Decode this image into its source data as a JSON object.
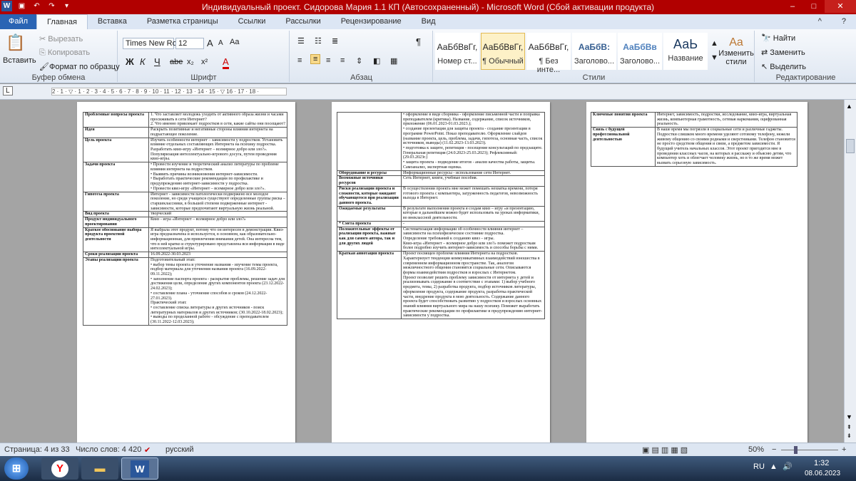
{
  "window": {
    "title": "Индивидуальный проект. Сидорова Мария 1.1 КП (Автосохраненный)  -  Microsoft Word (Сбой активации продукта)",
    "min": "–",
    "max": "□",
    "close": "✕",
    "app_icon": "W"
  },
  "ribbon_tabs": [
    "Файл",
    "Главная",
    "Вставка",
    "Разметка страницы",
    "Ссылки",
    "Рассылки",
    "Рецензирование",
    "Вид"
  ],
  "ribbon_right": {
    "help": "?",
    "collapse": "^"
  },
  "clipboard": {
    "paste": "Вставить",
    "cut": "Вырезать",
    "copy": "Копировать",
    "format": "Формат по образцу",
    "label": "Буфер обмена"
  },
  "font": {
    "name": "Times New Ro",
    "size": "12",
    "label": "Шрифт",
    "bold": "Ж",
    "italic": "К",
    "underline": "Ч",
    "strike": "abe",
    "sub": "x₂",
    "sup": "x²",
    "grow": "A",
    "shrink": "A",
    "clear": "Aa",
    "color": "A"
  },
  "paragraph": {
    "label": "Абзац",
    "pilcrow": "¶"
  },
  "styles": {
    "label": "Стили",
    "items": [
      {
        "preview": "АаБбВвГг,",
        "name": "Номер ст..."
      },
      {
        "preview": "АаБбВвГг,",
        "name": "¶ Обычный"
      },
      {
        "preview": "АаБбВвГг,",
        "name": "¶ Без инте..."
      },
      {
        "preview": "АаБбВ:",
        "name": "Заголово..."
      },
      {
        "preview": "АаБбВв",
        "name": "Заголово..."
      },
      {
        "preview": "АаЬ",
        "name": "Название"
      }
    ],
    "change": "Изменить стили"
  },
  "editing": {
    "label": "Редактирование",
    "find": "Найти",
    "replace": "Заменить",
    "select": "Выделить"
  },
  "ruler": {
    "corner": "L",
    "ticks": "2 · 1 · ▽ · 1 · 2 · 3 · 4 · 5 · 6 · 7 · 8 · 9 · 10 · 11 · 12 · 13 · 14 · 15 · ▽ 16 · 17 · 18 ·"
  },
  "page1": [
    {
      "k": "Проблемные вопросы проекта",
      "v": [
        "1. Что заставляет молодежь уходить от активного образа жизни и часами просиживать в сети Интернет?",
        "2. Что именно привлекает подростков в сети, какие сайты они посещают?"
      ]
    },
    {
      "k": "Идея",
      "v": [
        "Раскрыть позитивные и негативные стороны влияния интернета на подрастающее поколение."
      ]
    },
    {
      "k": "Цель проекта",
      "v": [
        "Изучить особенности интернет – зависимости у подростков. Установить влияние отдельных составляющих Интернета на психику подростка. Разработать квиз-игру «Интернет – всемирное добро или зло?». Популяризация интеллектуально-игрового досуга, путем проведения квиз-игры."
      ]
    },
    {
      "k": "Задачи проекта",
      "v": [
        "• Провести изучение и теоретический анализ литературы по проблеме влияния интернета на подростков.",
        "• Выявить причины возникновения интернет-зависимости.",
        "• Выработать практические рекомендации по профилактике и предупреждению интернет-зависимости у подростка.",
        "• Провести квиз-игру «Интернет – всемирное добро или зло?»."
      ]
    },
    {
      "k": "Гипотеза проекта",
      "v": [
        "Интернет - зависимости патологически подвержено все молодое поколение, но среди учащихся существуют определенные группы риска – старшеклассники, в большей степени подверженные интернет - зависимости, которые предпочитают виртуальную жизнь реальной."
      ]
    },
    {
      "k": "Вид проекта",
      "v": [
        "творческий"
      ]
    },
    {
      "k": "Продукт индивидуального проектирования",
      "v": [
        "Квиз - игра «Интернет – всемирное добро или зло?»"
      ]
    },
    {
      "k": "Краткое обоснование выбора продукта проектной деятельности",
      "v": [
        "Я выбрала этот продукт, потому что он интересен в демонстрации. Квиз-игра предназначена и используется, в основном, как образовательно-информационная, для привлечения внимания детей. Она интересна тем, что в ней кратко и структурировано представлена вся информация в виде интеллектуальной игры."
      ]
    },
    {
      "k": "Сроки реализации проекта",
      "v": [
        "16.09.2022-30.03.2023"
      ]
    },
    {
      "k": "Этапы реализации проекта",
      "v": [
        "Подготовительный этап:",
        "• выбор темы проекта и уточнение названия - изучение темы проекта, подбор материала для уточнения названия проекта (16.09.2022-09.11.2022);",
        "• заполнение паспорта проекта - раскрытие проблемы, решение задач для достижения цели, определение других компонентов проекта (23.12.2022-24.02.2023);",
        "• составление плана - уточнение способов и сроков (24.12.2022-27.01.2023).",
        "Практический этап:",
        "• составление списка литературы и других источников - поиск литературных материалов и других источников; (30.10.2022-18.02.2023);",
        "• выводы по проделанной работе - обсуждение с преподавателем (30.11.2022-12.03.2023);"
      ]
    }
  ],
  "page2": [
    {
      "k": "",
      "v": [
        "• оформление в виде сборника - оформление письменной части и поправка преподавателем (критика). Название, содержание, список источников, приложение (06.01.2023-01.03.2023.);",
        "• создание презентации для защиты проекта - создание презентации в программе PowerPoint. Показ преподавателю. Оформление слайдов (название проекта, цель, проблема, задачи, гипотеза, основная часть, список источников, выводы) (11.02.2023-13.03.2023).",
        "• подготовка к защите, репетиция - посещение консультаций по предзащите. Генеральная репетиция (24.0.2023-25.03.2023); Рефлексивный: (29.03.2023г.)",
        "• защита проекта - подведение итогов - анализ качества работы, защиты. Самоанализ, экспертная оценка."
      ]
    },
    {
      "k": "Оборудование и ресурсы",
      "v": [
        "Информационные ресурсы - использование сети Интернет."
      ]
    },
    {
      "k": "Возможные источники ресурсов",
      "v": [
        "Сеть Интернет, книги, учебные пособия."
      ]
    },
    {
      "k": "Риски реализации проекта и сложности, которые ожидают обучающегося при реализации данного проекта.",
      "v": [
        "В осуществлении проекта мне может помешать нехватка времени, потеря готового проекта с компьютера, загруженность педагогов, невозможность выхода в Интернет."
      ]
    },
    {
      "k": "Ожидаемые результаты",
      "v": [
        "В результате выполнения проекта я создам квиз – игру «и презентацию, которые в дальнейшем можно будет использовать на уроках информатики, во внеклассной деятельности."
      ]
    },
    {
      "k": "* Смета проекта",
      "v": [
        "-"
      ]
    },
    {
      "k": "Положительные эффекты от реализации проекта, важные как для самого автора, так и для других людей",
      "v": [
        "Систематизация информации об особенности влияния интернет – зависимости на психофизическое состояние подростка.",
        "Определение требований к созданию квиз – игры.",
        "Квиз-игра «Интернет – всемирное добро или зло?» поможет подросткам более подробно изучить интернет-зависимость и способы борьбы с ними."
      ]
    },
    {
      "k": "Краткая аннотация проекта",
      "v": [
        "Проект посвящен проблеме влияния Интернета на подростков. Характеризует тенденции коммуникативных взаимодействий юношества в современном информационном пространстве. Так, аналогом межличностного общения становятся социальные сети. Описываются формы взаимодействия подростков и взрослых с Интернетом.",
        "Проект позволит решить проблему зависимости от интернета у детей и реализовывать содержание в соответствие с этапами: 1) выбор учебного предмета, темы, 2) разработка продукта, подбор источников литературы, оформление продукта, содержание продукта, разработка практической части, внедрение продукта в мою деятельность. Содержание данного проекта будет способствовать развитию у подростков и взрослых основных знаний влияния виртуального мира на нашу психику. Поможет выработать практические рекомендации по профилактике и предупреждению интернет-зависимости у подростка."
      ]
    }
  ],
  "page3": [
    {
      "k": "Ключевые понятия проекта",
      "v": [
        "Интернет, зависимость, подростки, исследование, квиз-игра, виртуальная жизнь, компьютерная грамотность, сетевая наркомания, оцифрованная реальность."
      ]
    },
    {
      "k": "Связь с будущей профессиональной деятельностью",
      "v": [
        "В наше время мы погрязли в социальные сети и различные гаджеты.",
        "Подростки слишком много времени уделяют сотовому телефону, нежели живому общению со своими родными и сверстниками. Телефон становится не просто средством общения и связи, а предметом зависимости. Я будущий учитель начальных классов. Этот проект пригодится мне в проведении классных часов, на которых я расскажу и объясню детям, что компьютер хоть и облегчает человеку жизнь, но в то же время может вызвать серьезную зависимость."
      ]
    }
  ],
  "status": {
    "page": "Страница: 4 из 33",
    "words": "Число слов: 4 420",
    "lang": "русский",
    "zoom": "50%",
    "zoom_minus": "−",
    "zoom_plus": "+"
  },
  "taskbar": {
    "lang": "RU",
    "time": "1:32",
    "date": "08.06.2023"
  }
}
